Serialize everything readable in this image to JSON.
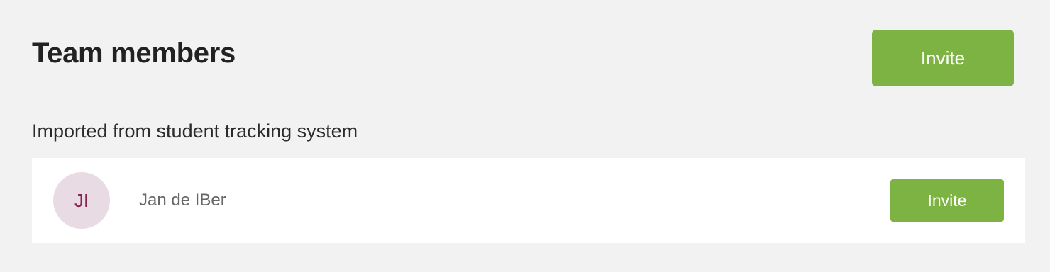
{
  "colors": {
    "page_background": "#f2f2f2",
    "accent_green": "#7cb342",
    "avatar_background": "#e9dbe3",
    "avatar_text": "#8a2051",
    "card_background": "#ffffff"
  },
  "header": {
    "title": "Team members",
    "invite_label": "Invite"
  },
  "section": {
    "heading": "Imported from student tracking system"
  },
  "members": [
    {
      "initials": "JI",
      "name": "Jan de IBer",
      "invite_label": "Invite"
    }
  ]
}
